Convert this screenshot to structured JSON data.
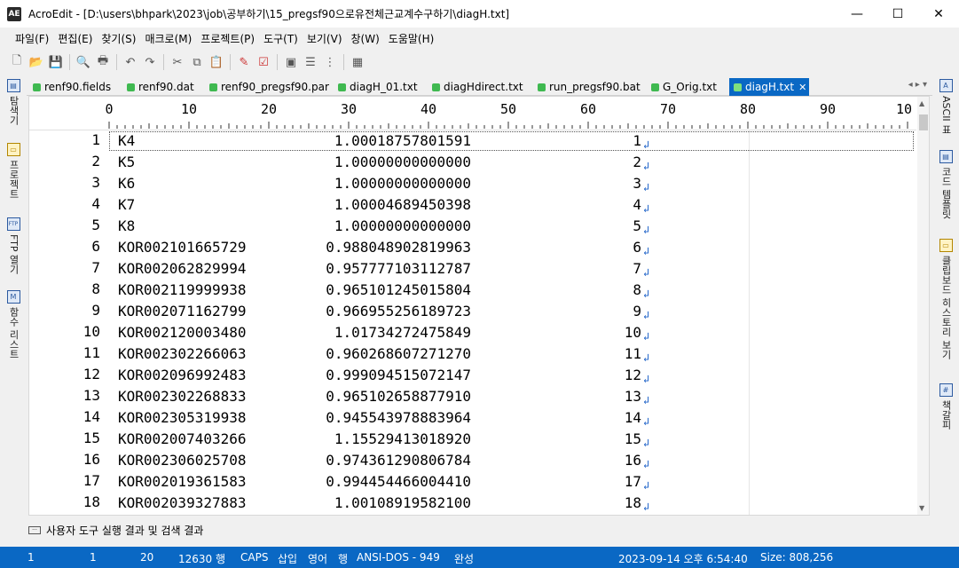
{
  "window": {
    "title": "AcroEdit - [D:\\users\\bhpark\\2023\\job\\공부하기\\15_pregsf90으로유전체근교계수구하기\\diagH.txt]",
    "minimize": "—",
    "maximize": "☐",
    "close": "✕"
  },
  "menu": [
    "파일(F)",
    "편집(E)",
    "찾기(S)",
    "매크로(M)",
    "프로젝트(P)",
    "도구(T)",
    "보기(V)",
    "창(W)",
    "도움말(H)"
  ],
  "toolbar_icons": [
    "new-file-icon",
    "open-folder-icon",
    "save-icon",
    "print-preview-icon",
    "print-icon",
    "undo-icon",
    "redo-icon",
    "cut-icon",
    "copy-icon",
    "paste-icon",
    "marker-icon",
    "compare-icon",
    "window-icon",
    "list-icon",
    "dots-icon",
    "calendar-icon"
  ],
  "left_panels": [
    {
      "label": "탐색기"
    },
    {
      "label": "프로젝트"
    },
    {
      "label": "FTP 열기"
    },
    {
      "label": "함수 리스트"
    }
  ],
  "right_panels": [
    {
      "label": "ASCII 표"
    },
    {
      "label": "코드 템플릿"
    },
    {
      "label": "클립보드 히스토리 보기"
    },
    {
      "label": "책갈피"
    }
  ],
  "tabs": [
    {
      "label": "renf90.fields",
      "active": false
    },
    {
      "label": "renf90.dat",
      "active": false
    },
    {
      "label": "renf90_pregsf90.par",
      "active": false
    },
    {
      "label": "diagH_01.txt",
      "active": false
    },
    {
      "label": "diagHdirect.txt",
      "active": false
    },
    {
      "label": "run_pregsf90.bat",
      "active": false
    },
    {
      "label": "G_Orig.txt",
      "active": false
    },
    {
      "label": "diagH.txt",
      "active": true
    }
  ],
  "tab_nav": "◂ ▸ ▾",
  "ruler": [
    "0",
    "10",
    "20",
    "30",
    "40",
    "50",
    "60",
    "70",
    "80",
    "90",
    "10"
  ],
  "lines": [
    {
      "n": "1",
      "id": "K4",
      "val": "1.00018757801591",
      "idx": "1"
    },
    {
      "n": "2",
      "id": "K5",
      "val": "1.00000000000000",
      "idx": "2"
    },
    {
      "n": "3",
      "id": "K6",
      "val": "1.00000000000000",
      "idx": "3"
    },
    {
      "n": "4",
      "id": "K7",
      "val": "1.00004689450398",
      "idx": "4"
    },
    {
      "n": "5",
      "id": "K8",
      "val": "1.00000000000000",
      "idx": "5"
    },
    {
      "n": "6",
      "id": "KOR002101665729",
      "val": "0.988048902819963",
      "idx": "6"
    },
    {
      "n": "7",
      "id": "KOR002062829994",
      "val": "0.957777103112787",
      "idx": "7"
    },
    {
      "n": "8",
      "id": "KOR002119999938",
      "val": "0.965101245015804",
      "idx": "8"
    },
    {
      "n": "9",
      "id": "KOR002071162799",
      "val": "0.966955256189723",
      "idx": "9"
    },
    {
      "n": "10",
      "id": "KOR002120003480",
      "val": "1.01734272475849",
      "idx": "10"
    },
    {
      "n": "11",
      "id": "KOR002302266063",
      "val": "0.960268607271270",
      "idx": "11"
    },
    {
      "n": "12",
      "id": "KOR002096992483",
      "val": "0.999094515072147",
      "idx": "12"
    },
    {
      "n": "13",
      "id": "KOR002302268833",
      "val": "0.965102658877910",
      "idx": "13"
    },
    {
      "n": "14",
      "id": "KOR002305319938",
      "val": "0.945543978883964",
      "idx": "14"
    },
    {
      "n": "15",
      "id": "KOR002007403266",
      "val": "1.15529413018920",
      "idx": "15"
    },
    {
      "n": "16",
      "id": "KOR002306025708",
      "val": "0.974361290806784",
      "idx": "16"
    },
    {
      "n": "17",
      "id": "KOR002019361583",
      "val": "0.994454466004410",
      "idx": "17"
    },
    {
      "n": "18",
      "id": "KOR002039327883",
      "val": "1.00108919582100",
      "idx": "18"
    }
  ],
  "eol_mark": "↲",
  "output_tab": "사용자 도구 실행 결과 및 검색 결과",
  "status": {
    "line": "1",
    "col": "1",
    "col2": "20",
    "total_lines": "12630 행",
    "caps": "CAPS",
    "insert": "삽입",
    "lang": "영어",
    "row_mode": "행",
    "encoding": "ANSI-DOS - 949",
    "state": "완성",
    "datetime": "2023-09-14 오후 6:54:40",
    "size": "Size: 808,256"
  },
  "colors": {
    "accent": "#0a68c4",
    "tab_dot": "#3fb950",
    "eol": "#1a5fc7"
  }
}
